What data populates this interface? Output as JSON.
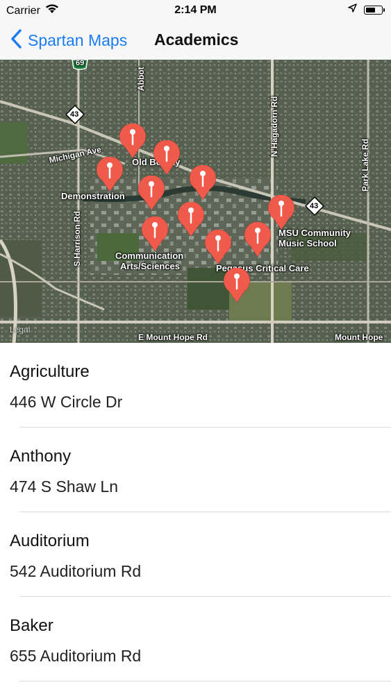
{
  "status_bar": {
    "carrier": "Carrier",
    "time": "2:14 PM",
    "icons": [
      "wifi-icon",
      "location-arrow-icon",
      "battery-icon"
    ]
  },
  "nav": {
    "back_label": "Spartan Maps",
    "title": "Academics"
  },
  "map": {
    "labels": {
      "michigan_ave": "Michigan Ave",
      "old_botany": "Old Botany",
      "demonstration": "Demonstration",
      "communication": "Communication",
      "arts_sciences": "Arts/Sciences",
      "msu_community": "MSU Community",
      "music_school": "Music School",
      "pegasus": "Pegasus Critical Care",
      "mount_hope": "E Mount Hope Rd",
      "mount_hope_right": "Mount Hope",
      "hagadorn": "N Hagadorn Rd",
      "harrison": "S Harrison Rd",
      "park_lake": "Park Lake Rd",
      "abbot": "Abbot",
      "shield_43_left": "43",
      "shield_43_right": "43",
      "shield_69": "69",
      "legal": "Legal"
    },
    "pin_color": "#f05a4b",
    "pin_count": 11
  },
  "locations": [
    {
      "name": "Agriculture",
      "address": "446 W Circle Dr"
    },
    {
      "name": "Anthony",
      "address": "474 S Shaw Ln"
    },
    {
      "name": "Auditorium",
      "address": "542 Auditorium Rd"
    },
    {
      "name": "Baker",
      "address": "655 Auditorium Rd"
    }
  ]
}
